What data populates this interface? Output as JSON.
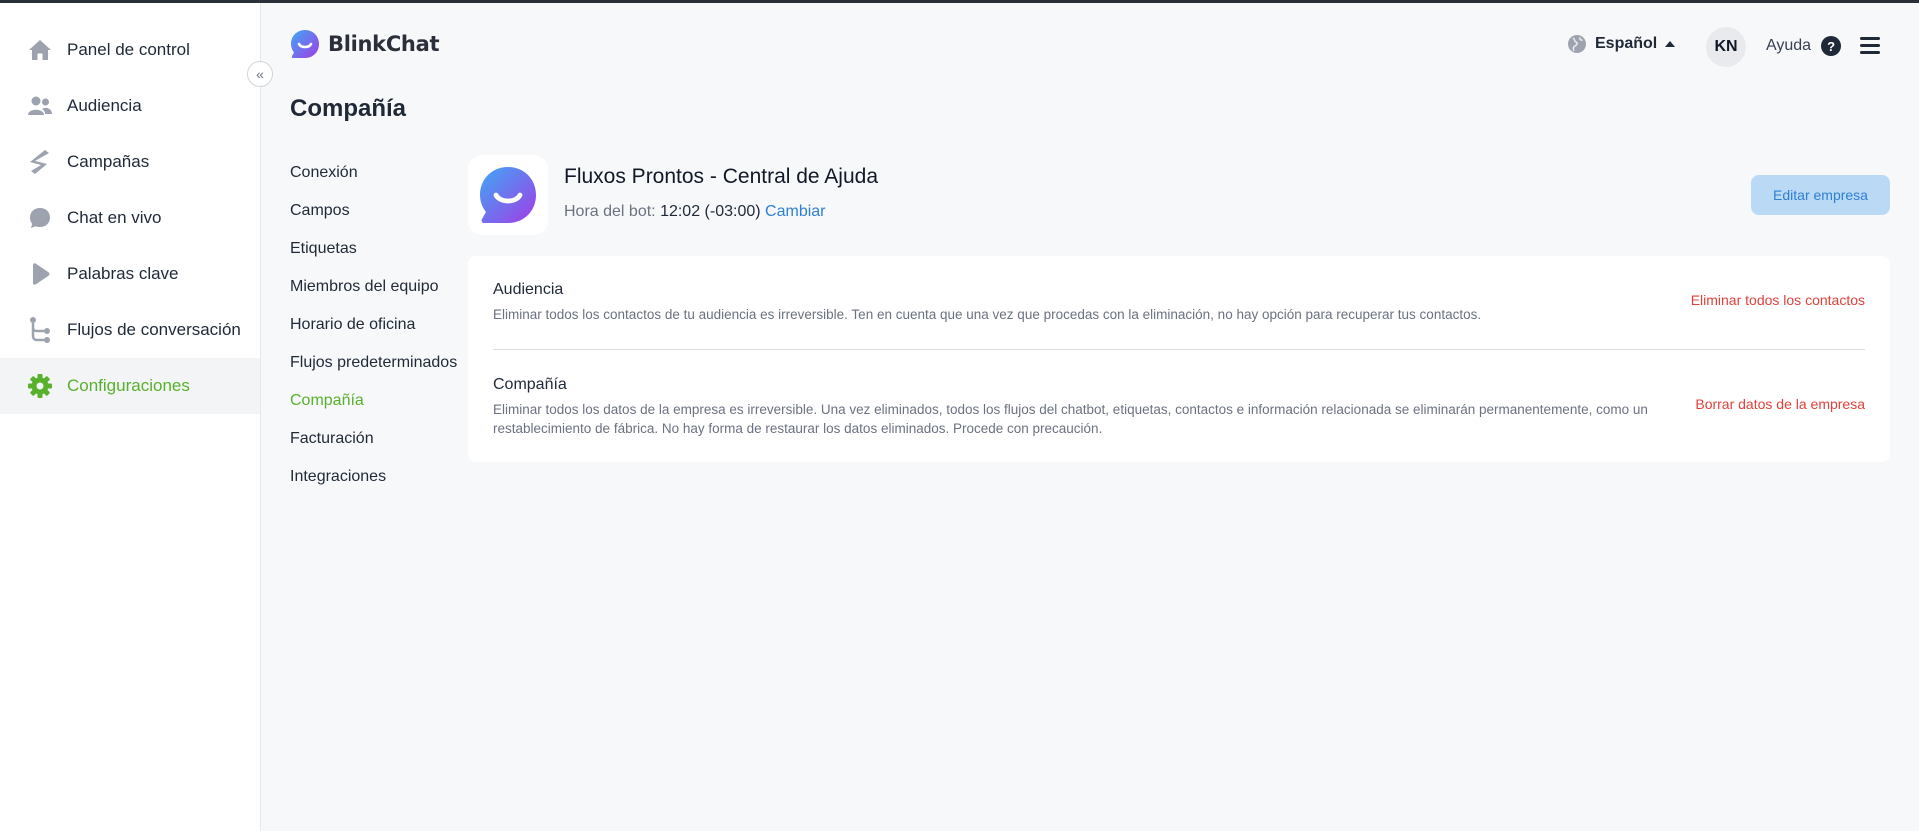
{
  "sidebar": {
    "collapse_label": "«",
    "items": [
      {
        "label": "Panel de control",
        "icon": "home-icon"
      },
      {
        "label": "Audiencia",
        "icon": "users-icon"
      },
      {
        "label": "Campañas",
        "icon": "campaign-icon"
      },
      {
        "label": "Chat en vivo",
        "icon": "chat-bubble-icon"
      },
      {
        "label": "Palabras clave",
        "icon": "play-icon"
      },
      {
        "label": "Flujos de conversación",
        "icon": "flow-icon"
      },
      {
        "label": "Configuraciones",
        "icon": "gear-icon",
        "active": true
      }
    ]
  },
  "header": {
    "brand": "BlinkChat",
    "language": "Español",
    "avatar_initials": "KN",
    "help_label": "Ayuda",
    "help_glyph": "?"
  },
  "page": {
    "title": "Compañía"
  },
  "settings_nav": [
    {
      "label": "Conexión"
    },
    {
      "label": "Campos"
    },
    {
      "label": "Etiquetas"
    },
    {
      "label": "Miembros del equipo"
    },
    {
      "label": "Horario de oficina"
    },
    {
      "label": "Flujos predeterminados"
    },
    {
      "label": "Compañía",
      "active": true
    },
    {
      "label": "Facturación"
    },
    {
      "label": "Integraciones"
    }
  ],
  "company": {
    "name": "Fluxos Prontos - Central de Ajuda",
    "bot_time_label": "Hora del bot: ",
    "bot_time_value": "12:02 (-03:00)",
    "change_link": "Cambiar",
    "edit_button": "Editar empresa"
  },
  "danger_zone": [
    {
      "title": "Audiencia",
      "description": "Eliminar todos los contactos de tu audiencia es irreversible. Ten en cuenta que una vez que procedas con la eliminación, no hay opción para recuperar tus contactos.",
      "action": "Eliminar todos los contactos"
    },
    {
      "title": "Compañía",
      "description": "Eliminar todos los datos de la empresa es irreversible. Una vez eliminados, todos los flujos del chatbot, etiquetas, contactos e información relacionada se eliminarán permanentemente, como un restablecimiento de fábrica. No hay forma de restaurar los datos eliminados. Procede con precaución.",
      "action": "Borrar datos de la empresa"
    }
  ],
  "colors": {
    "accent_green": "#58b12c",
    "link_blue": "#2f7fd3",
    "danger_red": "#e0413b",
    "edit_button_bg": "#b9d9f5"
  }
}
